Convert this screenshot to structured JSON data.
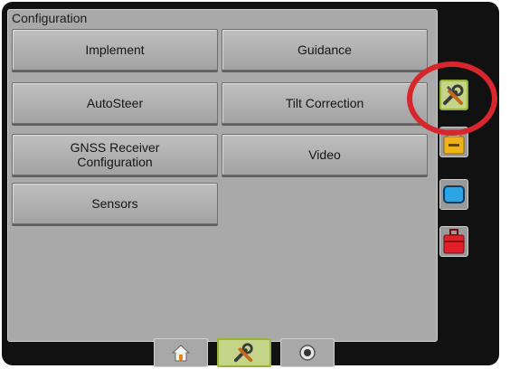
{
  "panel": {
    "title": "Configuration"
  },
  "menu": {
    "implement": "Implement",
    "guidance": "Guidance",
    "autosteer": "AutoSteer",
    "tilt_correction": "Tilt Correction",
    "gnss_line1": "GNSS Receiver",
    "gnss_line2": "Configuration",
    "video": "Video",
    "sensors": "Sensors"
  },
  "side_tabs": [
    {
      "icon": "wrench-screwdriver-icon",
      "active": true
    },
    {
      "icon": "yellow-printer-icon",
      "active": false
    },
    {
      "icon": "blue-screen-icon",
      "active": false
    },
    {
      "icon": "red-toolbox-icon",
      "active": false
    }
  ],
  "bottom_bar": [
    {
      "icon": "home-icon",
      "active": false
    },
    {
      "icon": "wrench-screwdriver-icon",
      "active": true
    },
    {
      "icon": "camera-icon",
      "active": false
    }
  ],
  "colors": {
    "active_tab": "#c4d58a",
    "highlight_circle": "#d7262c"
  }
}
